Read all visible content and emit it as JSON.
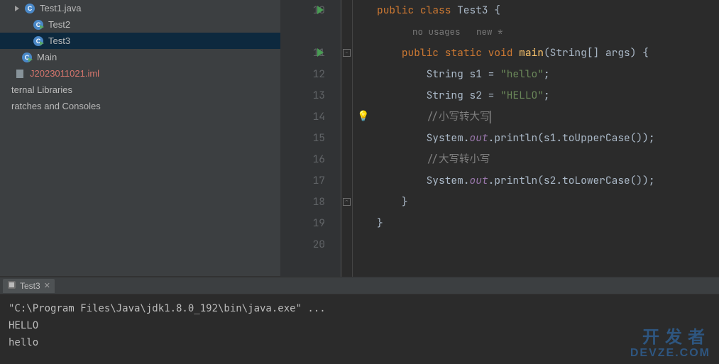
{
  "sidebar": {
    "items": [
      {
        "label": "Test1.java",
        "indent": 18,
        "icon": "java",
        "expander": true
      },
      {
        "label": "Test2",
        "indent": 30,
        "icon": "run",
        "expander": false
      },
      {
        "label": "Test3",
        "indent": 30,
        "icon": "run",
        "expander": false,
        "selected": true
      },
      {
        "label": "Main",
        "indent": 14,
        "icon": "run",
        "expander": false
      },
      {
        "label": "J2023011021.iml",
        "indent": 4,
        "icon": "file",
        "expander": false,
        "color": "#d5756c"
      },
      {
        "label": "ternal Libraries",
        "indent": 0,
        "icon": "",
        "expander": false
      },
      {
        "label": "ratches and Consoles",
        "indent": 0,
        "icon": "",
        "expander": false
      }
    ]
  },
  "editor": {
    "hints": {
      "no_usages": "no usages",
      "new": "new *"
    },
    "lines": [
      {
        "n": 10,
        "run": true,
        "code": [
          [
            "kw",
            "public "
          ],
          [
            "kw",
            "class "
          ],
          [
            "id",
            "Test3 {"
          ]
        ]
      },
      {
        "n": null,
        "hint": true
      },
      {
        "n": 11,
        "run": true,
        "fold": "-",
        "indent": 4,
        "code": [
          [
            "kw",
            "public "
          ],
          [
            "kw",
            "static "
          ],
          [
            "kw",
            "void "
          ],
          [
            "def",
            "main"
          ],
          [
            "id",
            "(String[] args) {"
          ]
        ]
      },
      {
        "n": 12,
        "indent": 8,
        "code": [
          [
            "id",
            "String s1 = "
          ],
          [
            "str",
            "\"hello\""
          ],
          [
            "id",
            ";"
          ]
        ]
      },
      {
        "n": 13,
        "indent": 8,
        "code": [
          [
            "id",
            "String s2 = "
          ],
          [
            "str",
            "\"HELLO\""
          ],
          [
            "id",
            ";"
          ]
        ]
      },
      {
        "n": 14,
        "bulb": true,
        "indent": 8,
        "caret": true,
        "code": [
          [
            "cmt",
            "//小写转大写"
          ]
        ]
      },
      {
        "n": 15,
        "indent": 8,
        "code": [
          [
            "id",
            "System."
          ],
          [
            "fld",
            "out"
          ],
          [
            "id",
            ".println(s1.toUpperCase());"
          ]
        ]
      },
      {
        "n": 16,
        "indent": 8,
        "code": [
          [
            "cmt",
            "//大写转小写"
          ]
        ]
      },
      {
        "n": 17,
        "indent": 8,
        "code": [
          [
            "id",
            "System."
          ],
          [
            "fld",
            "out"
          ],
          [
            "id",
            ".println(s2.toLowerCase());"
          ]
        ]
      },
      {
        "n": 18,
        "fold": "^",
        "indent": 4,
        "code": [
          [
            "id",
            "}"
          ]
        ]
      },
      {
        "n": 19,
        "indent": 0,
        "code": [
          [
            "id",
            "}"
          ]
        ]
      },
      {
        "n": 20,
        "indent": 0,
        "code": []
      }
    ]
  },
  "console": {
    "tab": "Test3",
    "lines": [
      "\"C:\\Program Files\\Java\\jdk1.8.0_192\\bin\\java.exe\" ...",
      "HELLO",
      "hello"
    ]
  },
  "watermark": {
    "cn": "开发者",
    "en": "DEVZE.COM"
  }
}
